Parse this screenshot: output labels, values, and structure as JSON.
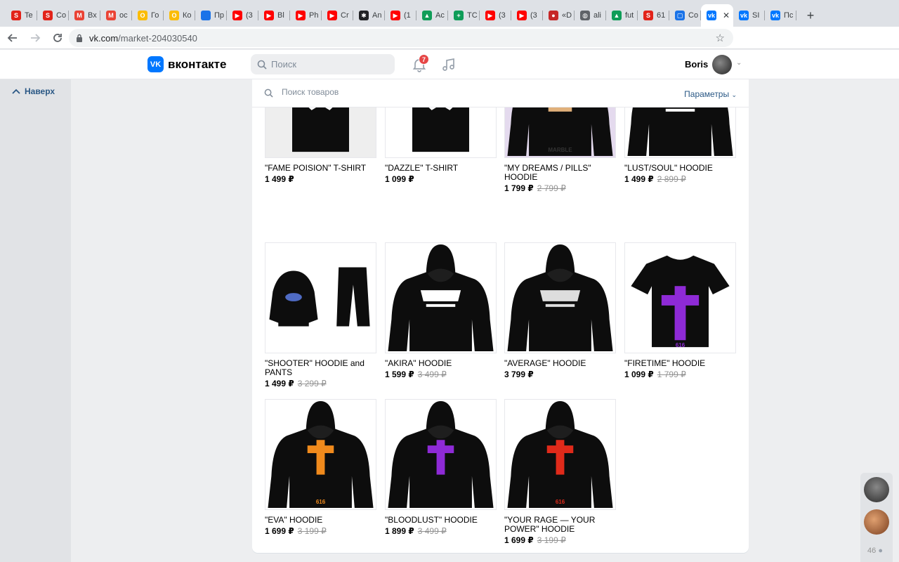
{
  "browser": {
    "tabs": [
      {
        "label": "Te",
        "color": "#e2231a",
        "glyph": "S"
      },
      {
        "label": "Co",
        "color": "#e2231a",
        "glyph": "S"
      },
      {
        "label": "Вх",
        "color": "#ea4335",
        "glyph": "M"
      },
      {
        "label": "ос",
        "color": "#ea4335",
        "glyph": "M"
      },
      {
        "label": "Го",
        "color": "#fbbc04",
        "glyph": "O"
      },
      {
        "label": "Ко",
        "color": "#fbbc04",
        "glyph": "O"
      },
      {
        "label": "Пр",
        "color": "#1a73e8",
        "glyph": ""
      },
      {
        "label": "(3",
        "color": "#ff0000",
        "glyph": "▶"
      },
      {
        "label": "Bl",
        "color": "#ff0000",
        "glyph": "▶"
      },
      {
        "label": "Ph",
        "color": "#ff0000",
        "glyph": "▶"
      },
      {
        "label": "Cr",
        "color": "#ff0000",
        "glyph": "▶"
      },
      {
        "label": "An",
        "color": "#202124",
        "glyph": "✱"
      },
      {
        "label": "(1",
        "color": "#ff0000",
        "glyph": "▶"
      },
      {
        "label": "Ac",
        "color": "#0f9d58",
        "glyph": "▲"
      },
      {
        "label": "TC",
        "color": "#0f9d58",
        "glyph": "+"
      },
      {
        "label": "(3",
        "color": "#ff0000",
        "glyph": "▶"
      },
      {
        "label": "(3",
        "color": "#ff0000",
        "glyph": "▶"
      },
      {
        "label": "«D",
        "color": "#c62828",
        "glyph": "●"
      },
      {
        "label": "ali",
        "color": "#5f6368",
        "glyph": "◍"
      },
      {
        "label": "fut",
        "color": "#0f9d58",
        "glyph": "▲"
      },
      {
        "label": "61",
        "color": "#e2231a",
        "glyph": "S"
      },
      {
        "label": "Co",
        "color": "#1a73e8",
        "glyph": "▢"
      },
      {
        "label": "",
        "color": "#0077ff",
        "glyph": "vk",
        "active": true
      },
      {
        "label": "SI",
        "color": "#0077ff",
        "glyph": "vk"
      },
      {
        "label": "Пс",
        "color": "#0077ff",
        "glyph": "vk"
      }
    ],
    "close_glyph": "✕",
    "newtab_glyph": "+",
    "url_host": "vk.com",
    "url_path": "/market-204030540"
  },
  "vk": {
    "logo_text": "вконтакте",
    "search_placeholder": "Поиск",
    "notifications_count": "7",
    "username": "Boris"
  },
  "sidebar": {
    "top_link": "Наверх"
  },
  "market": {
    "search_placeholder": "Поиск товаров",
    "params_label": "Параметры",
    "products": [
      {
        "title": "\"FAME POISION\" T-SHIRT",
        "price": "1 499 ₽",
        "old_price": "",
        "type": "tshirt",
        "bg": "#eeeeee",
        "print": "#ffffff"
      },
      {
        "title": "\"DAZZLE\" T-SHIRT",
        "price": "1 099 ₽",
        "old_price": "",
        "type": "tshirt",
        "bg": "#ffffff",
        "print": "#ffffff"
      },
      {
        "title": "\"MY DREAMS / PILLS\" HOODIE",
        "price": "1 799 ₽",
        "old_price": "2 799 ₽",
        "type": "hoodie",
        "bg": "#e4daee",
        "print": "#e0b07a",
        "caption": "MARBLE"
      },
      {
        "title": "\"LUST/SOUL\" HOODIE",
        "price": "1 499 ₽",
        "old_price": "2 899 ₽",
        "type": "hoodie",
        "bg": "#ffffff",
        "print": "#ffffff"
      },
      {
        "title": "\"SHOOTER\" HOODIE and PANTS",
        "price": "1 499 ₽",
        "old_price": "3 299 ₽",
        "type": "set",
        "bg": "#ffffff",
        "print": "#4f6bc4"
      },
      {
        "title": "\"AKIRA\" HOODIE",
        "price": "1 599 ₽",
        "old_price": "3 499 ₽",
        "type": "hoodie",
        "bg": "#ffffff",
        "print": "#ffffff"
      },
      {
        "title": "\"AVERAGE\" HOODIE",
        "price": "3 799 ₽",
        "old_price": "",
        "type": "hoodie",
        "bg": "#ffffff",
        "print": "#dddddd"
      },
      {
        "title": "\"FIRETIME\" HOODIE",
        "price": "1 099 ₽",
        "old_price": "1 799 ₽",
        "type": "tshirt",
        "bg": "#ffffff",
        "print": "#8e2ad6",
        "caption": "616"
      },
      {
        "title": "\"EVA\" HOODIE",
        "price": "1 699 ₽",
        "old_price": "3 199 ₽",
        "type": "hoodie",
        "bg": "#ffffff",
        "print": "#f08a1c",
        "caption": "616"
      },
      {
        "title": "\"BLOODLUST\" HOODIE",
        "price": "1 899 ₽",
        "old_price": "3 499 ₽",
        "type": "hoodie",
        "bg": "#ffffff",
        "print": "#8e2ad6"
      },
      {
        "title": "\"YOUR RAGE — YOUR POWER\" HOODIE",
        "price": "1 699 ₽",
        "old_price": "3 199 ₽",
        "type": "hoodie",
        "bg": "#ffffff",
        "print": "#e02a1a",
        "caption": "616"
      }
    ]
  },
  "chats": {
    "count": "46"
  },
  "colors": {
    "vk_blue": "#0077ff",
    "link": "#2a5885",
    "badge": "#e64646"
  }
}
